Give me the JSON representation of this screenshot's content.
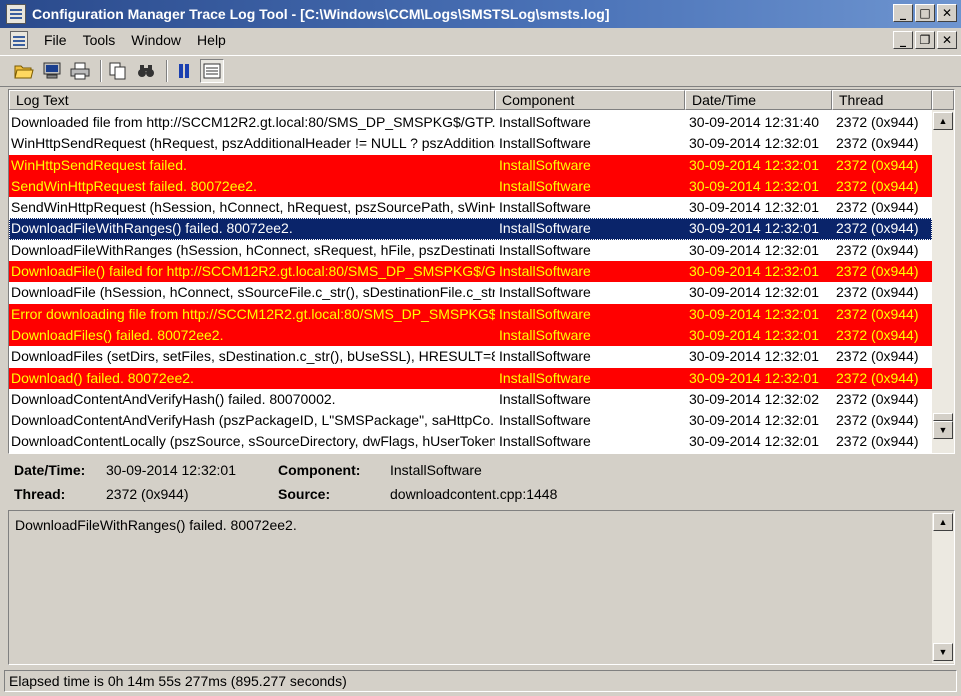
{
  "window": {
    "title": "Configuration Manager Trace Log Tool - [C:\\Windows\\CCM\\Logs\\SMSTSLog\\smsts.log]"
  },
  "menu": {
    "file": "File",
    "tools": "Tools",
    "window": "Window",
    "help": "Help"
  },
  "columns": {
    "log_text": "Log Text",
    "component": "Component",
    "datetime": "Date/Time",
    "thread": "Thread"
  },
  "rows": [
    {
      "text": "Downloaded file from http://SCCM12R2.gt.local:80/SMS_DP_SMSPKG$/GTP...",
      "component": "InstallSoftware",
      "datetime": "30-09-2014 12:31:40",
      "thread": "2372 (0x944)",
      "type": "normal"
    },
    {
      "text": "WinHttpSendRequest (hRequest, pszAdditionalHeader != NULL ? pszAdditiona...",
      "component": "InstallSoftware",
      "datetime": "30-09-2014 12:32:01",
      "thread": "2372 (0x944)",
      "type": "normal"
    },
    {
      "text": "WinHttpSendRequest failed.",
      "component": "InstallSoftware",
      "datetime": "30-09-2014 12:32:01",
      "thread": "2372 (0x944)",
      "type": "error"
    },
    {
      "text": "SendWinHttpRequest failed. 80072ee2.",
      "component": "InstallSoftware",
      "datetime": "30-09-2014 12:32:01",
      "thread": "2372 (0x944)",
      "type": "error"
    },
    {
      "text": "SendWinHttpRequest (hSession, hConnect, hRequest, pszSourcePath, sWinH...",
      "component": "InstallSoftware",
      "datetime": "30-09-2014 12:32:01",
      "thread": "2372 (0x944)",
      "type": "normal"
    },
    {
      "text": "DownloadFileWithRanges() failed. 80072ee2.",
      "component": "InstallSoftware",
      "datetime": "30-09-2014 12:32:01",
      "thread": "2372 (0x944)",
      "type": "selected"
    },
    {
      "text": "DownloadFileWithRanges (hSession, hConnect, sRequest, hFile, pszDestinatio...",
      "component": "InstallSoftware",
      "datetime": "30-09-2014 12:32:01",
      "thread": "2372 (0x944)",
      "type": "normal"
    },
    {
      "text": "DownloadFile() failed for http://SCCM12R2.gt.local:80/SMS_DP_SMSPKG$/G...",
      "component": "InstallSoftware",
      "datetime": "30-09-2014 12:32:01",
      "thread": "2372 (0x944)",
      "type": "error"
    },
    {
      "text": "DownloadFile (hSession, hConnect, sSourceFile.c_str(), sDestinationFile.c_str(),...",
      "component": "InstallSoftware",
      "datetime": "30-09-2014 12:32:01",
      "thread": "2372 (0x944)",
      "type": "normal"
    },
    {
      "text": "Error downloading file from http://SCCM12R2.gt.local:80/SMS_DP_SMSPKG$...",
      "component": "InstallSoftware",
      "datetime": "30-09-2014 12:32:01",
      "thread": "2372 (0x944)",
      "type": "error"
    },
    {
      "text": "DownloadFiles() failed. 80072ee2.",
      "component": "InstallSoftware",
      "datetime": "30-09-2014 12:32:01",
      "thread": "2372 (0x944)",
      "type": "error"
    },
    {
      "text": "DownloadFiles (setDirs, setFiles, sDestination.c_str(), bUseSSL), HRESULT=80...",
      "component": "InstallSoftware",
      "datetime": "30-09-2014 12:32:01",
      "thread": "2372 (0x944)",
      "type": "normal"
    },
    {
      "text": "Download() failed. 80072ee2.",
      "component": "InstallSoftware",
      "datetime": "30-09-2014 12:32:01",
      "thread": "2372 (0x944)",
      "type": "error"
    },
    {
      "text": "DownloadContentAndVerifyHash() failed. 80070002.",
      "component": "InstallSoftware",
      "datetime": "30-09-2014 12:32:02",
      "thread": "2372 (0x944)",
      "type": "normal"
    },
    {
      "text": "DownloadContentAndVerifyHash (pszPackageID, L\"SMSPackage\", saHttpCo...",
      "component": "InstallSoftware",
      "datetime": "30-09-2014 12:32:01",
      "thread": "2372 (0x944)",
      "type": "normal"
    },
    {
      "text": "DownloadContentLocally (pszSource, sSourceDirectory, dwFlags, hUserToken,...",
      "component": "InstallSoftware",
      "datetime": "30-09-2014 12:32:01",
      "thread": "2372 (0x944)",
      "type": "normal"
    }
  ],
  "details": {
    "datetime_label": "Date/Time:",
    "datetime_value": "30-09-2014 12:32:01",
    "component_label": "Component:",
    "component_value": "InstallSoftware",
    "thread_label": "Thread:",
    "thread_value": "2372 (0x944)",
    "source_label": "Source:",
    "source_value": "downloadcontent.cpp:1448"
  },
  "message": "DownloadFileWithRanges() failed. 80072ee2.",
  "status": "Elapsed time is 0h 14m 55s 277ms (895.277 seconds)",
  "colors": {
    "error_bg": "#ff0000",
    "error_fg": "#ffff00",
    "selected_bg": "#0a246a"
  },
  "icons": [
    "open-folder-icon",
    "computer-icon",
    "print-icon",
    "copy-icon",
    "find-icon",
    "pause-icon",
    "highlight-icon"
  ]
}
